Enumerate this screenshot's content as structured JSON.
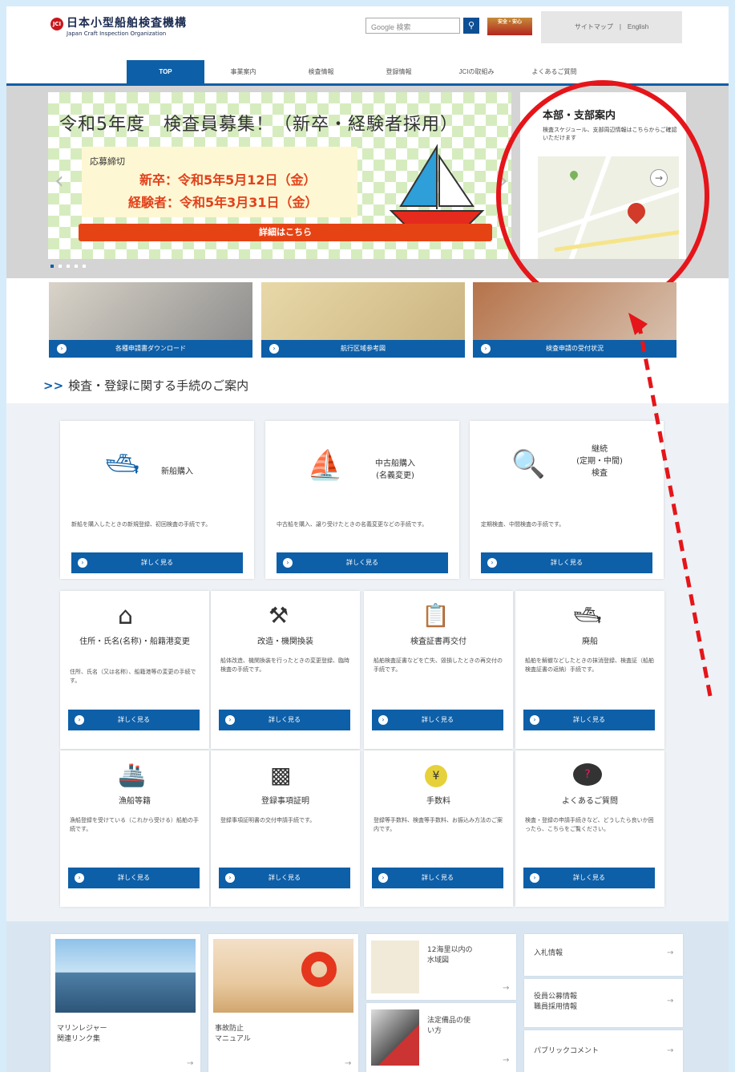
{
  "header": {
    "logo_mark": "JCI",
    "logo_jp": "日本小型船舶検査機構",
    "logo_en": "Japan Craft Inspection Organization",
    "search_placeholder": "Google 検索",
    "search_icon": "search-icon",
    "banner_text": "安全・安心",
    "util_text": "サイトマップ　|　English"
  },
  "nav": {
    "items": [
      "TOP",
      "事業案内",
      "検査情報",
      "登録情報",
      "JCIの取組み",
      "よくあるご質問"
    ]
  },
  "hero": {
    "slide_title": "令和5年度　検査員募集！（新卒・経験者採用）",
    "deadline_label": "応募締切",
    "deadline1": "新卒：令和5年5月12日（金）",
    "deadline2": "経験者：令和5年3月31日（金）",
    "detail_button": "詳細はこちら",
    "arrow_left": "‹",
    "arrow_right": "›",
    "branch_title": "本部・支部案内",
    "branch_desc": "検査スケジュール、支部周辺情報はこちらからご確認いただけます",
    "map_arrow": "→"
  },
  "quick_links": [
    {
      "label": "各種申請書ダウンロード"
    },
    {
      "label": "航行区域参考図"
    },
    {
      "label": "検査申請の受付状況"
    }
  ],
  "section_title": "検査・登録に関する手続のご案内",
  "detail_label": "詳しく見る",
  "cards_top": [
    {
      "name": "新船購入",
      "desc": "新船を購入したときの新規登録、初回検査の手続です。",
      "icon": "boat-sparkle-icon"
    },
    {
      "name": "中古船購入\n(名義変更)",
      "desc": "中古船を購入、譲り受けたときの名義変更などの手続です。",
      "icon": "sailboat-icon"
    },
    {
      "name": "継続\n(定期・中間)\n検査",
      "desc": "定期検査、中間検査の手続です。",
      "icon": "check-magnifier-icon"
    }
  ],
  "cards_mid": [
    {
      "name": "住所・氏名(名称)・船籍港変更",
      "desc": "住所、氏名（又は名称）、船籍港等の変更の手続です。",
      "icon": "house-icon"
    },
    {
      "name": "改造・機関換装",
      "desc": "船体改造、機関換装を行ったときの変更登録、臨時検査の手続です。",
      "icon": "tools-icon"
    },
    {
      "name": "検査証書再交付",
      "desc": "船舶検査証書などを亡失、毀損したときの再交付の手続です。",
      "icon": "certificate-icon"
    },
    {
      "name": "廃船",
      "desc": "船舶を解撤などしたときの抹消登録、検査証（船舶検査証書の返納）手続です。",
      "icon": "wrecked-boat-icon"
    }
  ],
  "cards_bot": [
    {
      "name": "漁船等籍",
      "desc": "漁船登録を受けている（これから受ける）船舶の手続です。",
      "icon": "fishing-boat-icon"
    },
    {
      "name": "登録事項証明",
      "desc": "登録事項証明書の交付申請手続です。",
      "icon": "stamp-icon"
    },
    {
      "name": "手数料",
      "desc": "登録等手数料、検査等手数料、お振込み方法のご案内です。",
      "icon": "yen-coin-icon"
    },
    {
      "name": "よくあるご質問",
      "desc": "検査・登録の申請手続きなど、どうしたら良いか困ったら、こちらをご覧ください。",
      "icon": "question-cloud-icon"
    }
  ],
  "footer": {
    "marina": "マリンレジャー\n関連リンク集",
    "accident": "事故防止\nマニュアル",
    "waters": "12海里以内の\n水域図",
    "equipment": "法定備品の使\nい方",
    "bid": "入札情報",
    "public": "役員公募情報\n職員採用情報",
    "comment": "パブリックコメント",
    "go": "→"
  }
}
